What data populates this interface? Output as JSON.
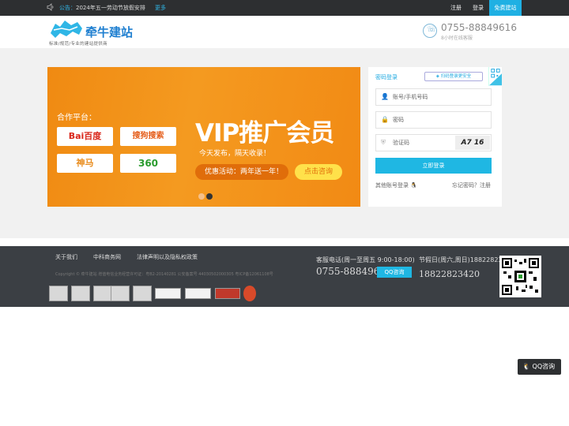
{
  "topbar": {
    "notice_label": "公告：",
    "notice_text": "2024年五一劳动节放假安排",
    "more": "更多",
    "register": "注册",
    "login": "登录",
    "free_build": "免费建站"
  },
  "header": {
    "logo_name": "牵牛建站",
    "logo_slogan": "标准/规范/专业的建站提供商",
    "phone": "0755-88849616",
    "phone_sub": "8小时在线客服"
  },
  "banner": {
    "partner_label": "合作平台：",
    "partners": [
      "Bai百度",
      "搜狗搜索",
      "神马",
      "360"
    ],
    "headline": "VIP推广会员",
    "subline": "今天发布，隔天收录！",
    "promo": "优惠活动：两年送一年！",
    "consult": "点击咨询"
  },
  "login": {
    "title": "密码登录",
    "scan": "扫码登录更安全",
    "account_placeholder": "账号/手机号码",
    "password_placeholder": "密码",
    "captcha_placeholder": "验证码",
    "captcha_text": "A7 16",
    "submit": "立即登录",
    "other_login": "其他账号登录",
    "forgot": "忘记密码？注册"
  },
  "footer": {
    "links": [
      "关于我们",
      "中科商务网",
      "法律声明以及隐私权政策"
    ],
    "copyright": "Copyright © 牵牛建站 增值电信业务经营许可证：粤B2-20140281 公安备案号 44030502000305 粤ICP备12061108号",
    "hotline_label": "客服电话(周一至周五 9:00-18:00)",
    "hotline_number": "0755-88849616",
    "qq_button": "QQ咨询",
    "holiday_label": "节假日(周六,周日)18822823420",
    "holiday_number": "18822823420"
  },
  "float": {
    "qq": "QQ咨询"
  },
  "colors": {
    "accent": "#1fb7e3",
    "banner_orange": "#f28a14",
    "dark": "#2d2f31",
    "footer_bg": "#3b3f44"
  },
  "icons": [
    "speaker-icon",
    "phone-icon",
    "user-icon",
    "lock-icon",
    "shield-icon",
    "qq-penguin-icon",
    "qr-code-icon"
  ]
}
